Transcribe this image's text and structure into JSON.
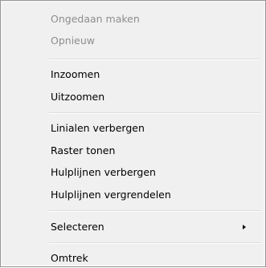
{
  "context_menu": {
    "items": [
      {
        "label": "Ongedaan maken"
      },
      {
        "label": "Opnieuw"
      },
      {
        "label": "Inzoomen"
      },
      {
        "label": "Uitzoomen"
      },
      {
        "label": "Linialen verbergen"
      },
      {
        "label": "Raster tonen"
      },
      {
        "label": "Hulplijnen verbergen"
      },
      {
        "label": "Hulplijnen vergrendelen"
      },
      {
        "label": "Selecteren"
      },
      {
        "label": "Omtrek"
      }
    ],
    "submenu_arrow_icon": "chevron-right-icon"
  }
}
